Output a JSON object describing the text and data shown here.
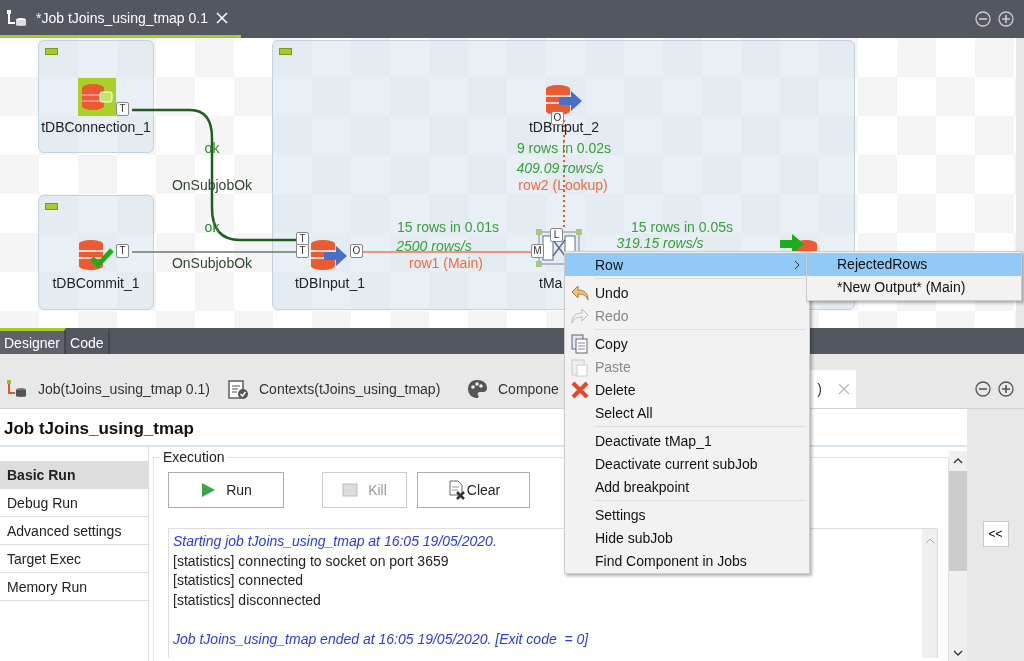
{
  "editor_tab": {
    "title": "*Job tJoins_using_tmap 0.1",
    "selected": true
  },
  "canvas": {
    "nodes": [
      {
        "name": "tDBConnection_1",
        "kind": "connection"
      },
      {
        "name": "tDBInput_2",
        "kind": "input"
      },
      {
        "name": "tDBCommit_1",
        "kind": "commit"
      },
      {
        "name": "tDBInput_1",
        "kind": "input"
      },
      {
        "name": "tMa",
        "kind": "map"
      },
      {
        "kind": "output"
      }
    ],
    "ports": [
      "T",
      "T",
      "T",
      "T",
      "O",
      "O",
      "M",
      "L"
    ],
    "link_labels": [
      {
        "text": "ok",
        "kind": "trigger"
      },
      {
        "text": "OnSubjobOk",
        "kind": "trigger-name"
      },
      {
        "text": "ok",
        "kind": "trigger"
      },
      {
        "text": "OnSubjobOk",
        "kind": "trigger-name"
      },
      {
        "text": "15 rows in 0.01s",
        "kind": "stats"
      },
      {
        "text": "2500 rows/s",
        "kind": "rate"
      },
      {
        "text": "row1 (Main)",
        "kind": "row"
      },
      {
        "text": "9 rows in 0.02s",
        "kind": "stats"
      },
      {
        "text": "409.09 rows/s",
        "kind": "rate"
      },
      {
        "text": "row2 (Lookup)",
        "kind": "row"
      },
      {
        "text": "15 rows in 0.05s",
        "kind": "stats"
      },
      {
        "text": "319.15 rows/s",
        "kind": "rate"
      }
    ]
  },
  "view_tabs": [
    {
      "label": "Designer",
      "selected": true
    },
    {
      "label": "Code",
      "selected": false
    }
  ],
  "bottom_tabs": [
    {
      "label": "Job(tJoins_using_tmap 0.1)",
      "selected": false
    },
    {
      "label": "Contexts(tJoins_using_tmap)",
      "selected": false
    },
    {
      "label": "Compone",
      "selected": false
    },
    {
      "label": ")",
      "selected": true
    }
  ],
  "run_panel": {
    "title": "Job tJoins_using_tmap",
    "side_tabs": [
      {
        "label": "Basic Run",
        "selected": true
      },
      {
        "label": "Debug Run",
        "selected": false
      },
      {
        "label": "Advanced settings",
        "selected": false
      },
      {
        "label": "Target Exec",
        "selected": false
      },
      {
        "label": "Memory Run",
        "selected": false
      }
    ],
    "group_label": "Execution",
    "buttons": [
      {
        "label": "Run",
        "disabled": false
      },
      {
        "label": "Kill",
        "disabled": true
      },
      {
        "label": "Clear",
        "disabled": false
      }
    ],
    "log": [
      {
        "text": "Starting job tJoins_using_tmap at 16:05 19/05/2020.",
        "kind": "info"
      },
      {
        "text": "[statistics] connecting to socket on port 3659",
        "kind": "plain"
      },
      {
        "text": "[statistics] connected",
        "kind": "plain"
      },
      {
        "text": "[statistics] disconnected",
        "kind": "plain"
      },
      {
        "text": "Job tJoins_using_tmap ended at 16:05 19/05/2020. [Exit code  = 0]",
        "kind": "info"
      }
    ],
    "collapse_button": "<<"
  },
  "context_menu": {
    "groups": [
      [
        {
          "label": "Row",
          "submenu": true,
          "selected": true,
          "disabled": false
        }
      ],
      [
        {
          "label": "Undo",
          "submenu": false,
          "selected": false,
          "disabled": false
        },
        {
          "label": "Redo",
          "submenu": false,
          "selected": false,
          "disabled": true
        }
      ],
      [
        {
          "label": "Copy",
          "submenu": false,
          "selected": false,
          "disabled": false
        },
        {
          "label": "Paste",
          "submenu": false,
          "selected": false,
          "disabled": true
        },
        {
          "label": "Delete",
          "submenu": false,
          "selected": false,
          "disabled": false
        },
        {
          "label": "Select All",
          "submenu": false,
          "selected": false,
          "disabled": false
        }
      ],
      [
        {
          "label": "Deactivate tMap_1",
          "submenu": false,
          "selected": false,
          "disabled": false
        },
        {
          "label": "Deactivate current subJob",
          "submenu": false,
          "selected": false,
          "disabled": false
        },
        {
          "label": "Add breakpoint",
          "submenu": false,
          "selected": false,
          "disabled": false
        }
      ],
      [
        {
          "label": "Settings",
          "submenu": false,
          "selected": false,
          "disabled": false
        },
        {
          "label": "Hide subJob",
          "submenu": false,
          "selected": false,
          "disabled": false
        },
        {
          "label": "Find Component in Jobs",
          "submenu": false,
          "selected": false,
          "disabled": false
        }
      ]
    ],
    "submenu": [
      {
        "label": "RejectedRows",
        "selected": true
      },
      {
        "label": "*New Output* (Main)",
        "selected": false
      }
    ]
  }
}
